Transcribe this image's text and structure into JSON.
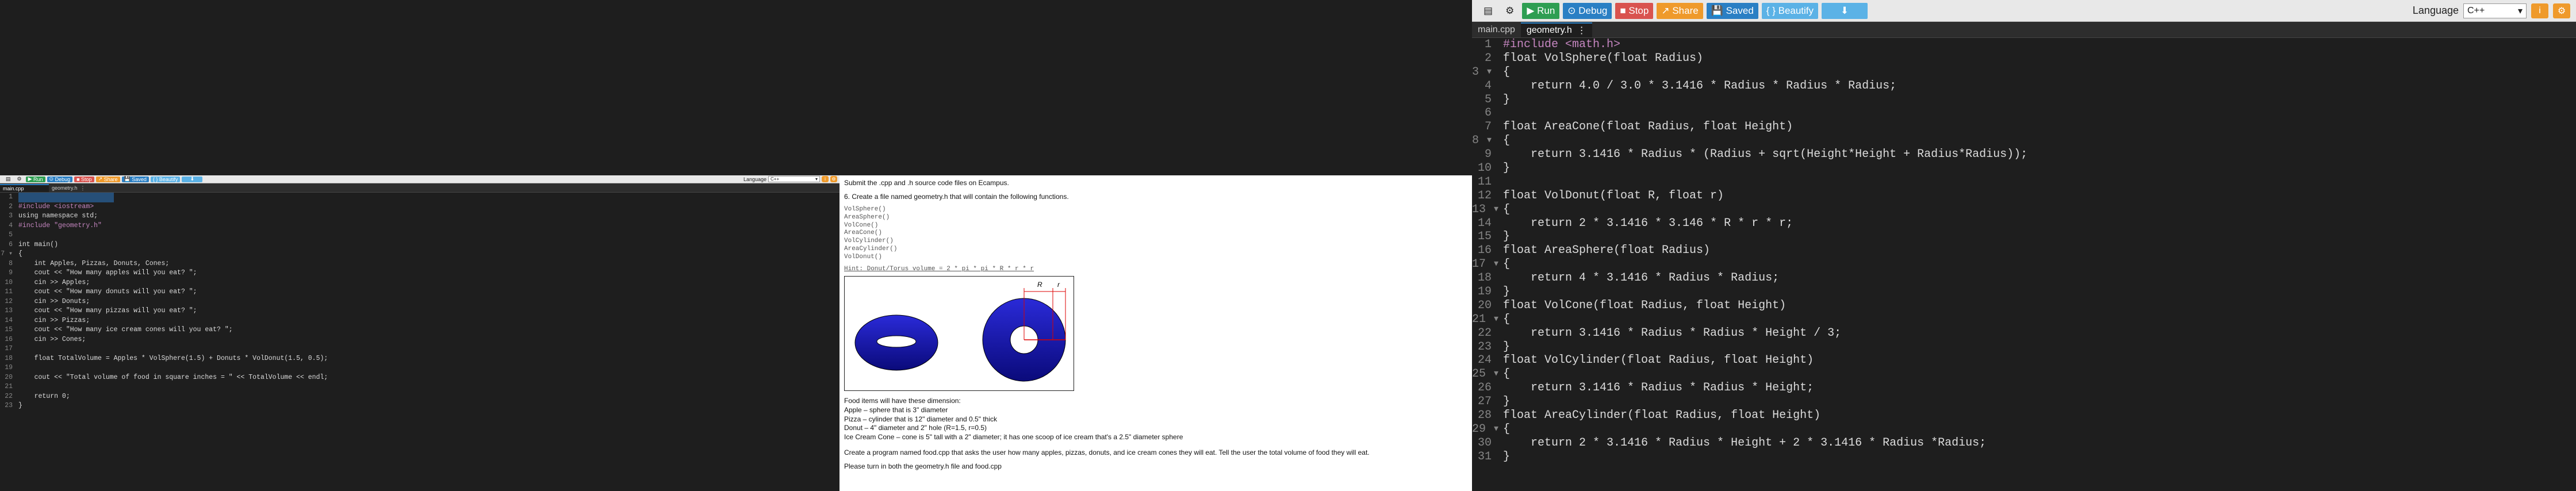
{
  "toolbar": {
    "run": "Run",
    "debug": "Debug",
    "stop": "Stop",
    "share": "Share",
    "saved": "Saved",
    "beautify": "{ } Beautify",
    "language_label": "Language",
    "language_value": "C++"
  },
  "left_ide": {
    "tabs": [
      "main.cpp",
      "geometry.h"
    ],
    "code": [
      "",
      "#include <iostream>",
      "using namespace std;",
      "#include \"geometry.h\"",
      "",
      "int main()",
      "{",
      "    int Apples, Pizzas, Donuts, Cones;",
      "    cout << \"How many apples will you eat? \";",
      "    cin >> Apples;",
      "    cout << \"How many donuts will you eat? \";",
      "    cin >> Donuts;",
      "    cout << \"How many pizzas will you eat? \";",
      "    cin >> Pizzas;",
      "    cout << \"How many ice cream cones will you eat? \";",
      "    cin >> Cones;",
      "",
      "    float TotalVolume = Apples * VolSphere(1.5) + Donuts * VolDonut(1.5, 0.5);",
      "",
      "    cout << \"Total volume of food in square inches = \" << TotalVolume << endl;",
      "",
      "    return 0;",
      "}"
    ]
  },
  "right_ide": {
    "tabs": [
      "main.cpp",
      "geometry.h"
    ],
    "code": [
      "#include <math.h>",
      "float VolSphere(float Radius)",
      "{",
      "    return 4.0 / 3.0 * 3.1416 * Radius * Radius * Radius;",
      "}",
      "",
      "float AreaCone(float Radius, float Height)",
      "{",
      "    return 3.1416 * Radius * (Radius + sqrt(Height*Height + Radius*Radius));",
      "}",
      "",
      "float VolDonut(float R, float r)",
      "{",
      "    return 2 * 3.1416 * 3.146 * R * r * r;",
      "}",
      "float AreaSphere(float Radius)",
      "{",
      "    return 4 * 3.1416 * Radius * Radius;",
      "}",
      "float VolCone(float Radius, float Height)",
      "{",
      "    return 3.1416 * Radius * Radius * Height / 3;",
      "}",
      "float VolCylinder(float Radius, float Height)",
      "{",
      "    return 3.1416 * Radius * Radius * Height;",
      "}",
      "float AreaCylinder(float Radius, float Height)",
      "{",
      "    return 2 * 3.1416 * Radius * Height + 2 * 3.1416 * Radius *Radius;",
      "}"
    ]
  },
  "doc": {
    "intro": "Submit the .cpp and .h source code files on Ecampus.",
    "task1": "6. Create a file named geometry.h that will contain the following functions.",
    "functions": [
      "VolSphere()",
      "AreaSphere()",
      "VolCone()",
      "AreaCone()",
      "VolCylinder()",
      "AreaCylinder()",
      "VolDonut()"
    ],
    "hint": "Hint: Donut/Torus volume = 2 * pi * pi * R * r * r",
    "fig_R": "R",
    "fig_r": "r",
    "dims_title": "Food items will have these dimension:",
    "dims": [
      "Apple – sphere that is 3\" diameter",
      "Pizza – cylinder that is 12\" diameter and 0.5\" thick",
      "Donut – 4\" diameter and 2\" hole  (R=1.5, r=0.5)",
      "Ice Cream Cone – cone is 5\" tall with a 2\" diameter; it has one scoop of ice cream that's a 2.5\" diameter sphere"
    ],
    "task2": "Create a program named food.cpp that asks the user how many apples, pizzas, donuts, and ice cream cones they will eat.  Tell the user the total volume of food they will eat.",
    "task3": "Please turn in both the geometry.h file and food.cpp"
  },
  "colors": {
    "run": "#2e9e52",
    "debug": "#2a7fc4",
    "stop": "#d9534f",
    "share": "#ef9a2b",
    "editor_bg": "#1e1e1e"
  }
}
